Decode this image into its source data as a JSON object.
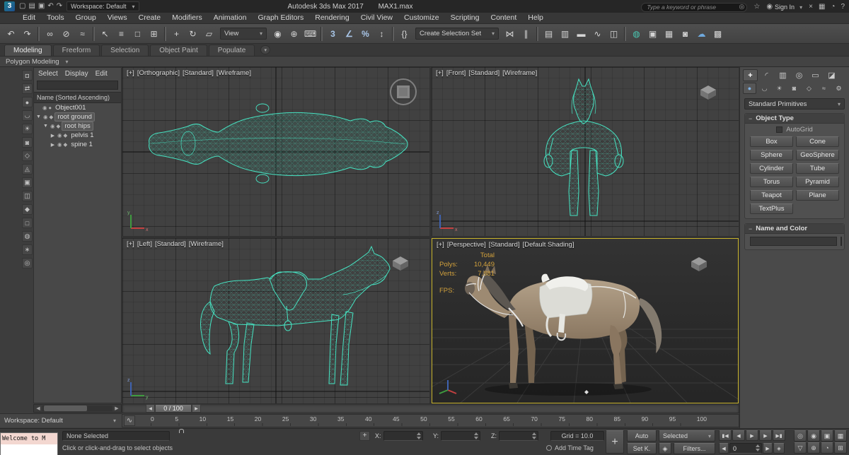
{
  "glyphs": {
    "caret": "▾",
    "minus": "−",
    "plus": "+",
    "left": "◀",
    "right": "▶",
    "vis": "◉",
    "geo": "●",
    "bone": "◆",
    "open": "▼",
    "closed": "▶",
    "user": "◉",
    "star": "☆",
    "search": "◎",
    "key_filter": "◈",
    "key_mode": "◈",
    "curve": "∿",
    "x": "x",
    "y": "y",
    "z": "z"
  },
  "titlebar": {
    "logo": "3",
    "quick_icons": [
      {
        "name": "new-scene-icon",
        "glyph": "▢"
      },
      {
        "name": "open-file-icon",
        "glyph": "▤"
      },
      {
        "name": "save-file-icon",
        "glyph": "▣"
      },
      {
        "name": "undo-quick-icon",
        "glyph": "↶"
      },
      {
        "name": "redo-quick-icon",
        "glyph": "↷"
      }
    ],
    "workspace": "Workspace: Default",
    "app_title": "Autodesk 3ds Max 2017",
    "file_name": "MAX1.max",
    "search_placeholder": "Type a keyword or phrase",
    "sign_in": "Sign In",
    "right_icons": [
      {
        "name": "x-badge-icon",
        "glyph": "×"
      },
      {
        "name": "apps-icon",
        "glyph": "▦"
      },
      {
        "name": "notifications-icon",
        "glyph": "◔"
      },
      {
        "name": "help-icon",
        "glyph": "?"
      }
    ]
  },
  "menubar": {
    "items": [
      "Edit",
      "Tools",
      "Group",
      "Views",
      "Create",
      "Modifiers",
      "Animation",
      "Graph Editors",
      "Rendering",
      "Civil View",
      "Customize",
      "Scripting",
      "Content",
      "Help"
    ]
  },
  "toolbar": {
    "group_a": [
      {
        "name": "undo-icon",
        "glyph": "↶"
      },
      {
        "name": "redo-icon",
        "glyph": "↷"
      },
      {
        "name": "toolbar-separator",
        "cls": "sep"
      },
      {
        "name": "select-and-link-icon",
        "glyph": "∞"
      },
      {
        "name": "unlink-selection-icon",
        "glyph": "⊘"
      },
      {
        "name": "bind-to-space-warp-icon",
        "glyph": "≈"
      },
      {
        "name": "toolbar-separator",
        "cls": "sep"
      },
      {
        "name": "select-object-icon",
        "glyph": "↖"
      },
      {
        "name": "select-by-name-icon",
        "glyph": "≡"
      },
      {
        "name": "rectangular-selection-region-icon",
        "glyph": "□"
      },
      {
        "name": "window-crossing-icon",
        "glyph": "⊞"
      },
      {
        "name": "toolbar-separator",
        "cls": "sep"
      },
      {
        "name": "select-and-move-icon",
        "glyph": "+"
      },
      {
        "name": "select-and-rotate-icon",
        "glyph": "↻"
      },
      {
        "name": "select-and-scale-icon",
        "glyph": "▱"
      }
    ],
    "view_dropdown": "View",
    "group_b": [
      {
        "name": "use-pivot-center-icon",
        "glyph": "◉"
      },
      {
        "name": "select-and-manipulate-icon",
        "glyph": "⊕"
      },
      {
        "name": "keyboard-override-icon",
        "glyph": "⌨"
      },
      {
        "name": "toolbar-separator",
        "cls": "sep"
      },
      {
        "name": "snaps-toggle-icon",
        "glyph": "3",
        "cls": "accent"
      },
      {
        "name": "angle-snap-icon",
        "glyph": "∠",
        "cls": "accent"
      },
      {
        "name": "percent-snap-icon",
        "glyph": "%",
        "cls": "accent"
      },
      {
        "name": "spinner-snap-icon",
        "glyph": "↕"
      },
      {
        "name": "toolbar-separator",
        "cls": "sep"
      },
      {
        "name": "edit-named-selection-sets-icon",
        "glyph": "{}"
      }
    ],
    "selection_set_dropdown": "Create Selection Set",
    "group_c": [
      {
        "name": "mirror-icon",
        "glyph": "⋈"
      },
      {
        "name": "align-icon",
        "glyph": "∥"
      },
      {
        "name": "toolbar-separator",
        "cls": "sep"
      },
      {
        "name": "toggle-scene-explorer-icon",
        "glyph": "▤"
      },
      {
        "name": "toggle-layer-explorer-icon",
        "glyph": "▥"
      },
      {
        "name": "toggle-ribbon-icon",
        "glyph": "▬"
      },
      {
        "name": "curve-editor-icon",
        "glyph": "∿"
      },
      {
        "name": "schematic-view-icon",
        "glyph": "◫"
      },
      {
        "name": "toolbar-separator",
        "cls": "sep"
      },
      {
        "name": "material-editor-icon",
        "glyph": "◍",
        "cls": "teal"
      },
      {
        "name": "render-setup-icon",
        "glyph": "▣"
      },
      {
        "name": "rendered-frame-window-icon",
        "glyph": "▦"
      },
      {
        "name": "render-production-icon",
        "glyph": "◙"
      },
      {
        "name": "render-in-cloud-icon",
        "glyph": "☁",
        "cls": "blue"
      },
      {
        "name": "render-gallery-icon",
        "glyph": "▩"
      }
    ]
  },
  "ribbon": {
    "tabs": [
      {
        "label": "Modeling",
        "cls": "active"
      },
      {
        "label": "Freeform"
      },
      {
        "label": "Selection"
      },
      {
        "label": "Object Paint"
      },
      {
        "label": "Populate"
      }
    ],
    "panel_label": "Polygon Modeling"
  },
  "explorer": {
    "menus": [
      "Select",
      "Display",
      "Edit"
    ],
    "header": "Name (Sorted Ascending)",
    "rows": [
      {
        "label": "Object001"
      },
      {
        "label": "root ground"
      },
      {
        "label": "root hips"
      },
      {
        "label": "pelvis 1"
      },
      {
        "label": "spine 1"
      }
    ],
    "strip": [
      {
        "name": "lock-cell-editing-icon",
        "glyph": "◘"
      },
      {
        "name": "sync-selection-icon",
        "glyph": "⇄"
      },
      {
        "name": "filter-geometry-icon",
        "glyph": "●"
      },
      {
        "name": "filter-shapes-icon",
        "glyph": "◡"
      },
      {
        "name": "filter-lights-icon",
        "glyph": "☀"
      },
      {
        "name": "filter-cameras-icon",
        "glyph": "◙"
      },
      {
        "name": "filter-helpers-icon",
        "glyph": "◇"
      },
      {
        "name": "filter-spacewarps-icon",
        "glyph": "◬"
      },
      {
        "name": "filter-groups-icon",
        "glyph": "▣"
      },
      {
        "name": "filter-xrefs-icon",
        "glyph": "◫"
      },
      {
        "name": "filter-bones-icon",
        "glyph": "◆"
      },
      {
        "name": "filter-containers-icon",
        "glyph": "□"
      },
      {
        "name": "filter-materials-icon",
        "glyph": "◍"
      },
      {
        "name": "filter-particles-icon",
        "glyph": "∗"
      },
      {
        "name": "find-icon",
        "glyph": "◎"
      }
    ]
  },
  "viewports": {
    "top_left": {
      "parts": [
        "[+]",
        "[Orthographic]",
        "[Standard]",
        "[Wireframe]"
      ]
    },
    "top_right": {
      "parts": [
        "[+]",
        "[Front]",
        "[Standard]",
        "[Wireframe]"
      ]
    },
    "bottom_left": {
      "parts": [
        "[+]",
        "[Left]",
        "[Standard]",
        "[Wireframe]"
      ]
    },
    "perspective": {
      "parts": [
        "[+]",
        "[Perspective]",
        "[Standard]",
        "[Default Shading]"
      ],
      "stats": {
        "total": "Total",
        "polys_label": "Polys:",
        "polys": "10,449",
        "verts_label": "Verts:",
        "verts": "7,881",
        "fps_label": "FPS:"
      }
    }
  },
  "command_panel": {
    "tabs": [
      {
        "name": "create-tab-icon",
        "glyph": "+",
        "cls": "active"
      },
      {
        "name": "modify-tab-icon",
        "glyph": "◜"
      },
      {
        "name": "hierarchy-tab-icon",
        "glyph": "▥"
      },
      {
        "name": "motion-tab-icon",
        "glyph": "◎"
      },
      {
        "name": "display-tab-icon",
        "glyph": "▭"
      },
      {
        "name": "utilities-tab-icon",
        "glyph": "◪"
      }
    ],
    "categories": [
      {
        "name": "geometry-category-icon",
        "glyph": "●",
        "cls": "active"
      },
      {
        "name": "shapes-category-icon",
        "glyph": "◡"
      },
      {
        "name": "lights-category-icon",
        "glyph": "☀"
      },
      {
        "name": "cameras-category-icon",
        "glyph": "◙"
      },
      {
        "name": "helpers-category-icon",
        "glyph": "◇"
      },
      {
        "name": "spacewarps-category-icon",
        "glyph": "≈"
      },
      {
        "name": "systems-category-icon",
        "glyph": "⚙"
      }
    ],
    "dropdown": "Standard Primitives",
    "object_type_title": "Object Type",
    "autogrid": "AutoGrid",
    "buttons": [
      "Box",
      "Cone",
      "Sphere",
      "GeoSphere",
      "Cylinder",
      "Tube",
      "Torus",
      "Pyramid",
      "Teapot",
      "Plane",
      "TextPlus"
    ],
    "name_color_title": "Name and Color"
  },
  "timeline": {
    "slider": "0 / 100",
    "ticks": [
      "0",
      "5",
      "10",
      "15",
      "20",
      "25",
      "30",
      "35",
      "40",
      "45",
      "50",
      "55",
      "60",
      "65",
      "70",
      "75",
      "80",
      "85",
      "90",
      "95",
      "100"
    ]
  },
  "workspace_bar": {
    "label": "Workspace: Default"
  },
  "statusbar": {
    "listener_text": "Welcome to M",
    "none_selected": "None Selected",
    "prompt": "Click or click-and-drag to select objects",
    "x_label": "X:",
    "y_label": "Y:",
    "z_label": "Z:",
    "grid": "Grid = 10.0",
    "add_time_tag": "Add Time Tag",
    "auto_key": "Auto",
    "selected": "Selected",
    "set_key": "Set K.",
    "filters": "Filters...",
    "frame": "0",
    "transport": [
      {
        "name": "goto-start-button",
        "glyph": "▮◀"
      },
      {
        "name": "previous-key-button",
        "glyph": "◀"
      },
      {
        "name": "play-button",
        "glyph": "▶"
      },
      {
        "name": "next-key-button",
        "glyph": "▶"
      },
      {
        "name": "goto-end-button",
        "glyph": "▶▮"
      }
    ],
    "nav": [
      {
        "name": "zoom-icon",
        "glyph": "◎"
      },
      {
        "name": "zoom-all-icon",
        "glyph": "◉"
      },
      {
        "name": "zoom-extents-icon",
        "glyph": "▣"
      },
      {
        "name": "zoom-extents-all-icon",
        "glyph": "▦"
      },
      {
        "name": "field-of-view-icon",
        "glyph": "▽"
      },
      {
        "name": "pan-view-icon",
        "glyph": "⊕"
      },
      {
        "name": "orbit-icon",
        "glyph": "◔"
      },
      {
        "name": "maximize-viewport-toggle-icon",
        "glyph": "⊞"
      }
    ]
  }
}
